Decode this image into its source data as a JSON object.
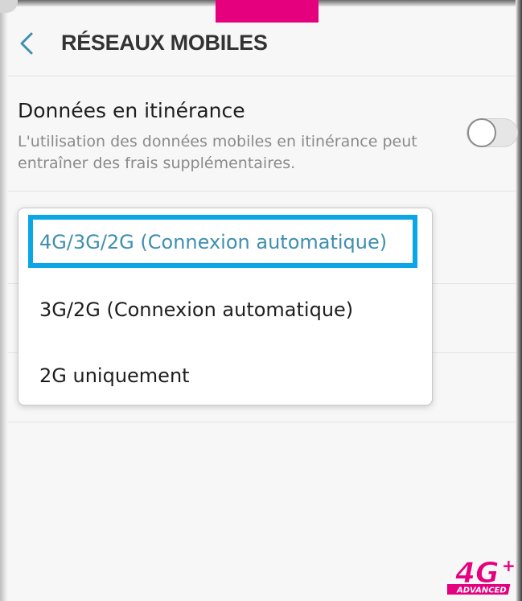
{
  "header": {
    "back_glyph": "‹",
    "title": "RÉSEAUX MOBILES"
  },
  "roaming": {
    "title": "Données en itinérance",
    "description": "L'utilisation des données mobiles en itinérance peut entraîner des frais supplémentaires.",
    "toggle_on": false
  },
  "network_mode_dropdown": {
    "options": [
      "4G/3G/2G (Connexion automatique)",
      "3G/2G (Connexion automatique)",
      "2G uniquement"
    ],
    "selected_index": 0
  },
  "logo": {
    "main": "4G",
    "plus": "+",
    "sub": "ADVANCED"
  },
  "colors": {
    "accent": "#3f8fb0",
    "highlight_box": "#0aa6e6",
    "brand_pink": "#e5007d"
  }
}
